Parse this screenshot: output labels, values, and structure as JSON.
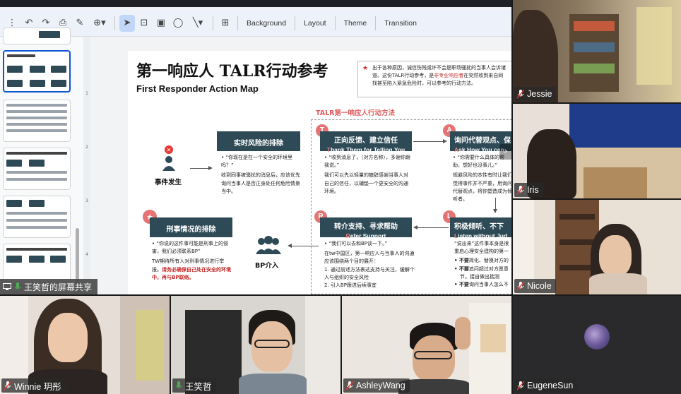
{
  "toolbar": {
    "menu_background": "Background",
    "menu_layout": "Layout",
    "menu_theme": "Theme",
    "menu_transition": "Transition"
  },
  "ruler_numbers": [
    "1",
    "2",
    "3",
    "4"
  ],
  "slide": {
    "title": "第一响应人 TALR行动参考",
    "subtitle": "First Responder Action Map",
    "note": {
      "line1": "出于各种原因，诚信伤残或许不会是职场骚扰的当事人会诉诸",
      "line2_a": "道。这份TALR行动参考，是",
      "line2_b": "非专业响应者",
      "line2_c": "在突然收到来自同",
      "line3": "找甚至陷入紧急危险时，可以参考的行动方法。"
    },
    "section_title": "TALR第一响应人行动方法",
    "event_label": "事件发生",
    "bp_label": "BP介入",
    "realtime": {
      "title": "实时风险的排除",
      "bullet": "•  “你现在是在一个安全的环境里吗？”",
      "body": "收到同事被骚扰的消息后，应该优先询问当事人是否正身处任何危险情景当中。"
    },
    "criminal": {
      "title": "刑事情况的排除",
      "bullet": "•  “你说的这件事可能是刑事上的侵害，我们必须联系BP”",
      "body_plain": "TW期待所有人对刑事情况进行举报。",
      "body_bold": "请务必确保自己处在安全的环境中，再与BP联络。"
    },
    "step_t": {
      "letter": "T",
      "title": "正向反馈、建立信任",
      "sub_first": "T",
      "sub_rest": "hank Them for Telling You",
      "bullet": "•  “收到消息了，（对方名称），多谢你跟我说。”",
      "body": "我们可以先以轻量的搪辞感谢当事人对自己的信任，以辅垫一个更安全的沟通环境。"
    },
    "step_a": {
      "letter": "A",
      "title": "询问代替观点、保",
      "sub_first": "A",
      "sub_rest": "sk How You can",
      "bullet": "•  “你需要什么具体的帮助，想好也没事儿。”",
      "body": "规避风险的本性有时让我们觉得事件并不严重，用询问代替观点，将你塑造成为倾听者。"
    },
    "step_r": {
      "letter": "R",
      "title": "转介支持、寻求帮助",
      "sub_first": "R",
      "sub_rest": "efer Support",
      "bullet": "•  “我们可以去和BP谈一下。”",
      "body": "在tw中国区，第一响应人与当事人的沟通应该围绕两个目的展开：",
      "item1": "1.  通过前述方法表达支持与关注，缓解个人与组织的安全风险",
      "item2": "2.  引入BP跟进后续事宜"
    },
    "step_l": {
      "letter": "L",
      "title": "积极倾听、不下",
      "sub_first": "L",
      "sub_rest": "isten without Jud",
      "line1": "“说出来”这件事本身是很",
      "line2": "重启心理安全建构的第一",
      "b1_bold": "•  不要",
      "b1_rest": "简化、替换对方的",
      "b2_bold": "•  不要",
      "b2_rest": "追问超过对方愿意",
      "b2_cont": "节。接自做出揣测",
      "b3_bold": "•  不要",
      "b3_rest": "询问当事人怎么不"
    }
  },
  "share_label": "王笑哲的屏幕共享",
  "participants": {
    "jessie": "Jessie",
    "iris": "Iris",
    "nicole": "Nicole",
    "winnie": "Winnie 玥彤",
    "wangxiaozhe": "王笑哲",
    "ashley": "AshleyWang",
    "eugene": "EugeneSun"
  }
}
